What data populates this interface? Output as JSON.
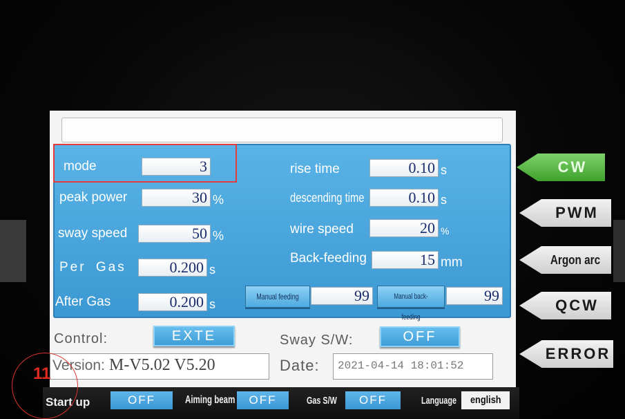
{
  "header": {
    "title": ""
  },
  "left_params": [
    {
      "label": "mode",
      "value": "3",
      "unit": ""
    },
    {
      "label": "peak power",
      "value": "30",
      "unit": "%"
    },
    {
      "label": "sway speed",
      "value": "50",
      "unit": "%"
    },
    {
      "label": "Per Gas",
      "value": "0.200",
      "unit": "s"
    },
    {
      "label": "After Gas",
      "value": "0.200",
      "unit": "s"
    }
  ],
  "right_params": [
    {
      "label": "rise time",
      "value": "0.10",
      "unit": "s"
    },
    {
      "label": "descending time",
      "value": "0.10",
      "unit": "s"
    },
    {
      "label": "wire speed",
      "value": "20",
      "unit": "%"
    },
    {
      "label": "Back-feeding",
      "value": "15",
      "unit": "mm"
    }
  ],
  "feeding": {
    "manual_label": "Manual feeding",
    "manual_value": "99",
    "back_label": "Manual back-feeding",
    "back_value": "99"
  },
  "control": {
    "label": "Control:",
    "value": "EXTE"
  },
  "sway": {
    "label": "Sway S/W:",
    "value": "OFF"
  },
  "version": {
    "label": "Version:",
    "value": "M-V5.02 V5.20"
  },
  "date": {
    "label": "Date:",
    "value": "2021-04-14 18:01:52"
  },
  "bottom_bar": {
    "startup_label": "Start up",
    "startup_value": "OFF",
    "aiming_label": "Aiming beam",
    "aiming_value": "OFF",
    "gas_label": "Gas S/W",
    "gas_value": "OFF",
    "language_label": "Language",
    "language_value": "english"
  },
  "modes": [
    {
      "label": "CW",
      "active": true
    },
    {
      "label": "PWM",
      "active": false
    },
    {
      "label": "Argon arc",
      "active": false
    },
    {
      "label": "QCW",
      "active": false
    },
    {
      "label": "ERROR",
      "active": false
    }
  ],
  "annotation": {
    "number": "11"
  },
  "colors": {
    "panel": "#4aa6dc",
    "active_tab": "#4caf38",
    "annotation": "#e02a20"
  }
}
